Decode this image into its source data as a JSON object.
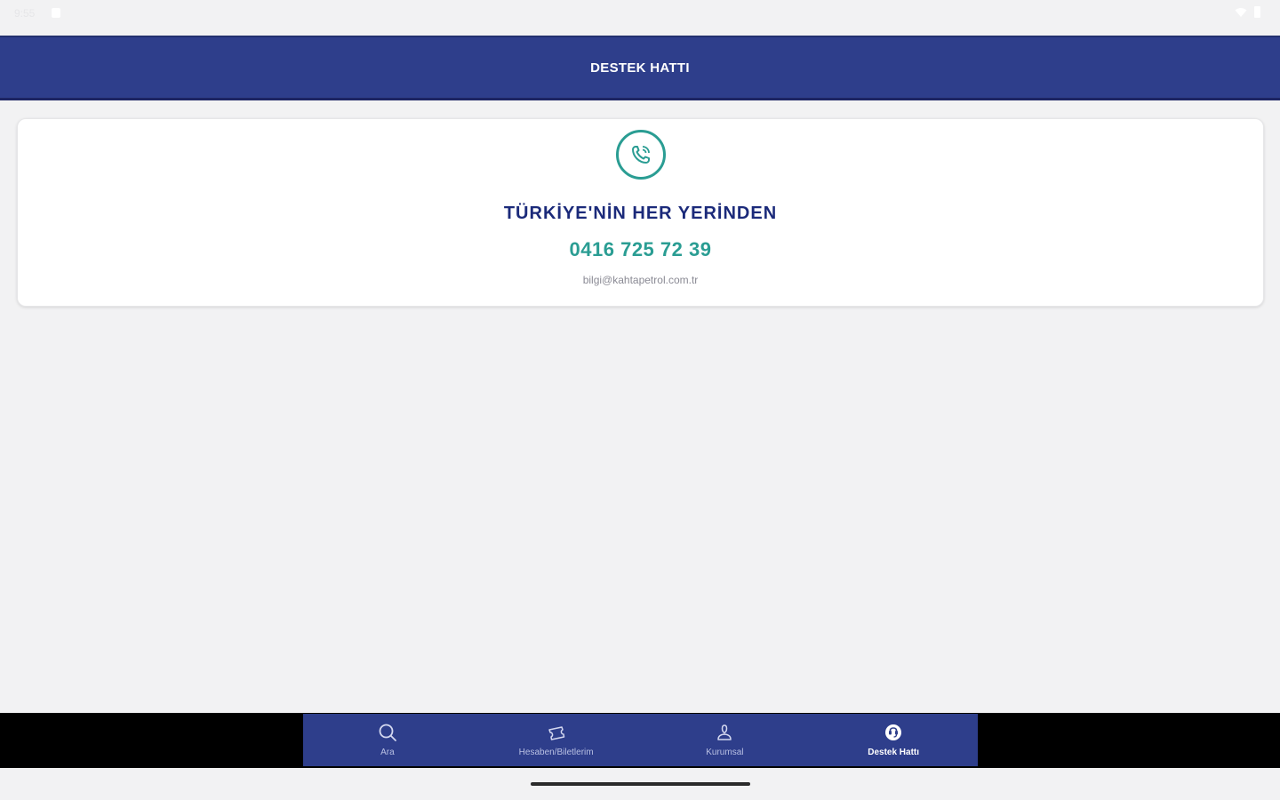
{
  "status_bar": {
    "time": "9:55",
    "notification_icon": "notification-icon",
    "wifi_icon": "wifi-icon",
    "battery_icon": "battery-icon"
  },
  "header": {
    "title": "DESTEK HATTI"
  },
  "card": {
    "icon": "phone-icon",
    "heading": "TÜRKİYE'NİN HER YERİNDEN",
    "phone": "0416 725 72 39",
    "email": "bilgi@kahtapetrol.com.tr"
  },
  "bottom_nav": {
    "items": [
      {
        "label": "Ara",
        "icon": "search-icon",
        "active": false
      },
      {
        "label": "Hesaben/Biletlerim",
        "icon": "ticket-icon",
        "active": false
      },
      {
        "label": "Kurumsal",
        "icon": "user-icon",
        "active": false
      },
      {
        "label": "Destek Hattı",
        "icon": "support-icon",
        "active": true
      }
    ]
  },
  "colors": {
    "primary": "#2e3e8b",
    "accent": "#2a9d93",
    "heading": "#1b2a7a",
    "background": "#f2f2f3"
  }
}
